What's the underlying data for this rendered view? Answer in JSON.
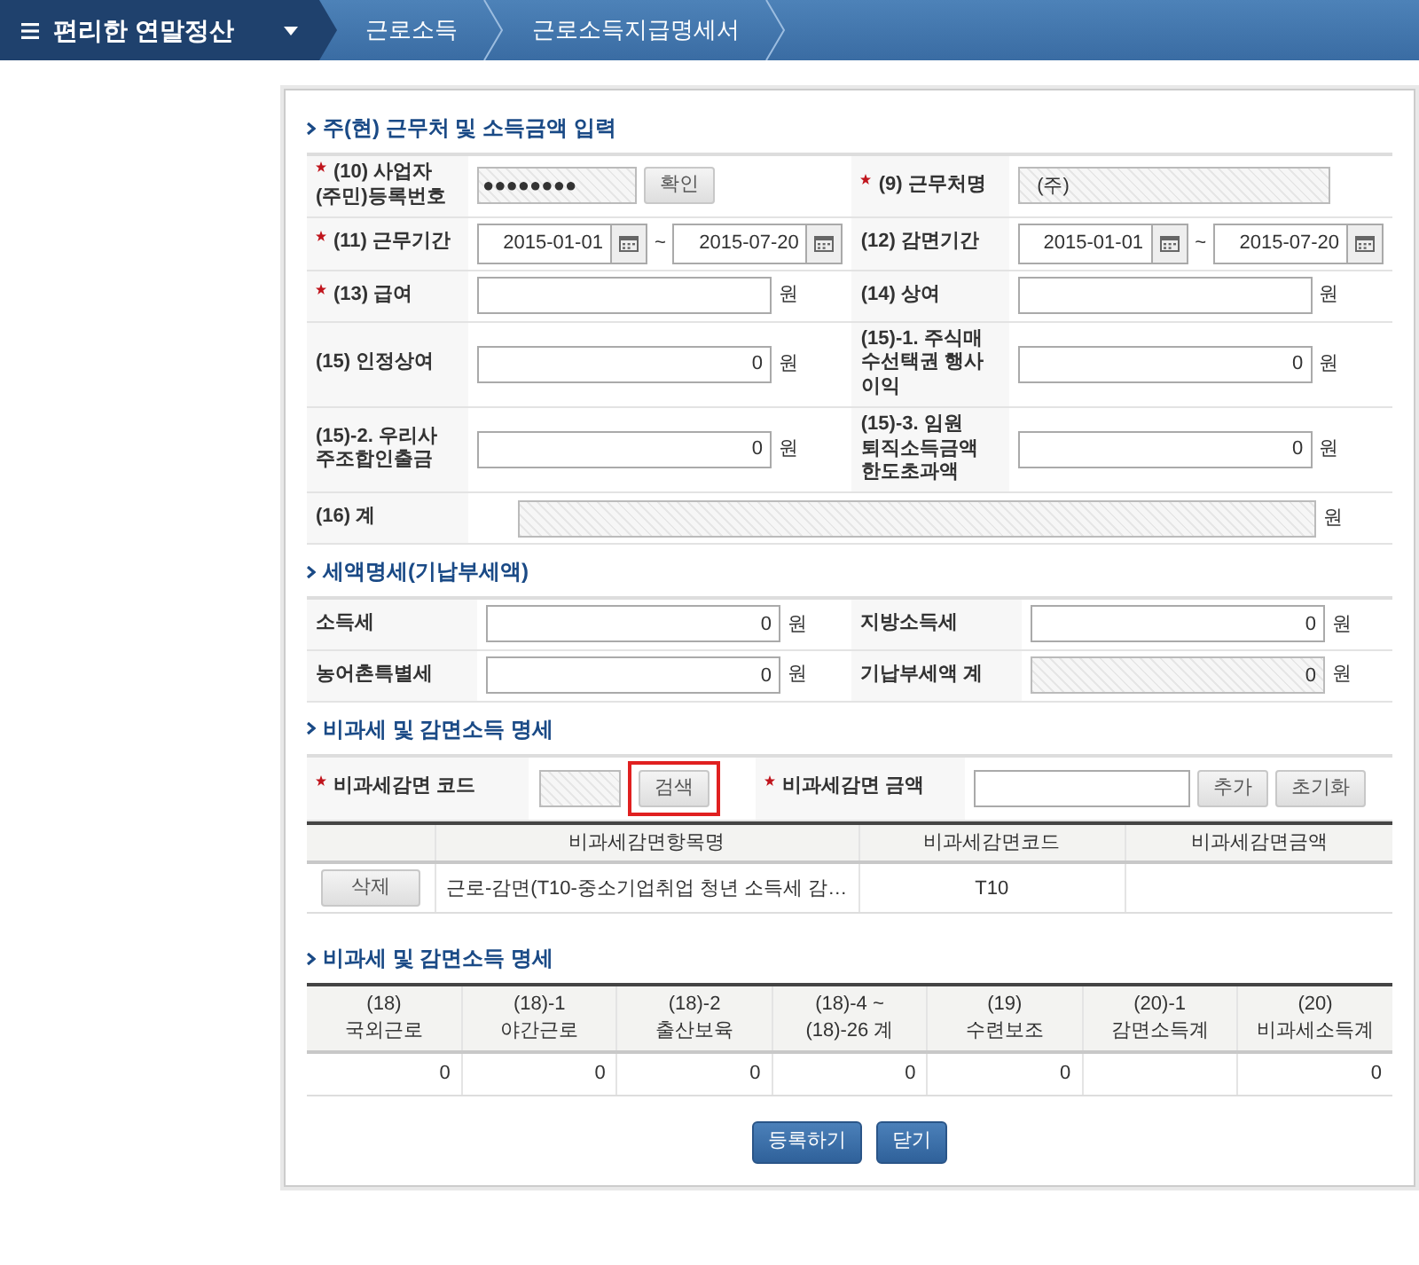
{
  "navbar": {
    "title": "편리한 연말정산",
    "breadcrumbs": [
      "근로소득",
      "근로소득지급명세서"
    ]
  },
  "income_section": {
    "title": "주(현) 근무처 및 소득금액 입력",
    "rows": [
      {
        "cells": [
          {
            "label": "(10) 사업자\n(주민)등록번호",
            "required": true,
            "field": {
              "kind": "masked",
              "value": "●●●●●●●●",
              "button": "확인"
            }
          },
          {
            "label": "(9) 근무처명",
            "required": true,
            "field": {
              "kind": "readonly",
              "value": "(주)"
            }
          }
        ]
      },
      {
        "cells": [
          {
            "label": "(11) 근무기간",
            "required": true,
            "field": {
              "kind": "date_range",
              "from": "2015-01-01",
              "to": "2015-07-20",
              "separator": "~"
            }
          },
          {
            "label": "(12) 감면기간",
            "required": false,
            "field": {
              "kind": "date_range",
              "from": "2015-01-01",
              "to": "2015-07-20",
              "separator": "~"
            }
          }
        ]
      },
      {
        "cells": [
          {
            "label": "(13) 급여",
            "required": true,
            "field": {
              "kind": "amount",
              "unit": "원",
              "readonly": false
            }
          },
          {
            "label": "(14) 상여",
            "required": false,
            "field": {
              "kind": "amount",
              "unit": "원",
              "readonly": false
            }
          }
        ]
      },
      {
        "cells": [
          {
            "label": "(15) 인정상여",
            "required": false,
            "field": {
              "kind": "amount",
              "value": "0",
              "unit": "원",
              "readonly": false
            }
          },
          {
            "label": "(15)-1. 주식매\n수선택권 행사\n이익",
            "required": false,
            "field": {
              "kind": "amount",
              "value": "0",
              "unit": "원",
              "readonly": false
            }
          }
        ]
      },
      {
        "cells": [
          {
            "label": "(15)-2. 우리사\n주조합인출금",
            "required": false,
            "field": {
              "kind": "amount",
              "value": "0",
              "unit": "원",
              "readonly": false
            }
          },
          {
            "label": "(15)-3. 임원\n퇴직소득금액\n한도초과액",
            "required": false,
            "field": {
              "kind": "amount",
              "value": "0",
              "unit": "원",
              "readonly": false
            }
          }
        ]
      },
      {
        "cells": [
          {
            "label": "(16) 계",
            "required": false,
            "wide": true,
            "field": {
              "kind": "amount",
              "unit": "원",
              "readonly": true
            }
          }
        ]
      }
    ]
  },
  "tax_section": {
    "title": "세액명세(기납부세액)",
    "rows": [
      {
        "cells": [
          {
            "label": "소득세",
            "required": false,
            "field": {
              "kind": "amount",
              "value": "0",
              "unit": "원",
              "readonly": false
            }
          },
          {
            "label": "지방소득세",
            "required": false,
            "field": {
              "kind": "amount",
              "value": "0",
              "unit": "원",
              "readonly": false
            }
          }
        ]
      },
      {
        "cells": [
          {
            "label": "농어촌특별세",
            "required": false,
            "field": {
              "kind": "amount",
              "value": "0",
              "unit": "원",
              "readonly": false
            }
          },
          {
            "label": "기납부세액 계",
            "required": false,
            "field": {
              "kind": "amount",
              "value": "0",
              "unit": "원",
              "readonly": true
            }
          }
        ]
      }
    ]
  },
  "exemption_section": {
    "title": "비과세 및 감면소득 명세",
    "search": {
      "code_label": "비과세감면 코드",
      "code_required": true,
      "search_button": "검색",
      "search_highlighted": true,
      "amount_label": "비과세감면 금액",
      "amount_required": true,
      "add_button": "추가",
      "reset_button": "초기화"
    },
    "table": {
      "columns": [
        "비과세감면항목명",
        "비과세감면코드",
        "비과세감면금액"
      ],
      "rows": [
        {
          "button": "삭제",
          "name": "근로-감면(T10-중소기업취업 청년 소득세 감…",
          "code": "T10"
        }
      ]
    }
  },
  "summary_section": {
    "title": "비과세 및 감면소득 명세",
    "columns": [
      {
        "header": "(18)\n국외근로",
        "value": "0"
      },
      {
        "header": "(18)-1\n야간근로",
        "value": "0"
      },
      {
        "header": "(18)-2\n출산보육",
        "value": "0"
      },
      {
        "header": "(18)-4 ~\n(18)-26 계",
        "value": "0"
      },
      {
        "header": "(19)\n수련보조",
        "value": "0"
      },
      {
        "header": "(20)-1\n감면소득계"
      },
      {
        "header": "(20)\n비과세소득계",
        "value": "0"
      }
    ]
  },
  "buttons": [
    "등록하기",
    "닫기"
  ]
}
